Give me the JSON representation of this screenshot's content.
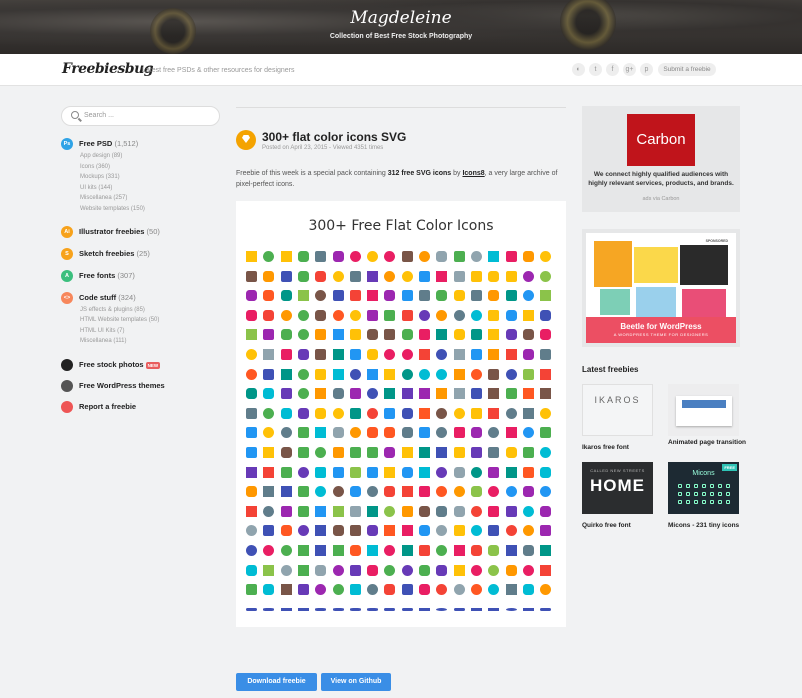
{
  "banner": {
    "title": "Magdeleine",
    "subtitle": "Collection of Best Free Stock Photography"
  },
  "header": {
    "logo": "Freebiesbug",
    "tagline": "Latest free PSDs & other resources for designers",
    "social": [
      "rss-icon",
      "twitter-icon",
      "facebook-icon",
      "google-plus-icon",
      "pinterest-icon"
    ],
    "social_glyphs": [
      "◐",
      "t",
      "f",
      "g+",
      "p"
    ],
    "submit_label": "Submit a freebie"
  },
  "sidebar": {
    "search_placeholder": "Search ...",
    "categories": [
      {
        "badge": "Ps",
        "color": "#2fa3e6",
        "label": "Free PSD",
        "count": "(1,512)",
        "subs": [
          "App design (89)",
          "Icons (360)",
          "Mockups (331)",
          "UI kits (144)",
          "Miscellanea (257)",
          "Website templates (150)"
        ]
      },
      {
        "badge": "Ai",
        "color": "#f7a21b",
        "label": "Illustrator freebies",
        "count": "(50)",
        "subs": []
      },
      {
        "badge": "S",
        "color": "#f7a21b",
        "label": "Sketch freebies",
        "count": "(25)",
        "subs": []
      },
      {
        "badge": "A",
        "color": "#3bbf7d",
        "label": "Free fonts",
        "count": "(307)",
        "subs": []
      },
      {
        "badge": "<>",
        "color": "#f7875b",
        "label": "Code stuff",
        "count": "(324)",
        "subs": [
          "JS effects & plugins (85)",
          "HTML Website templates (50)",
          "HTML UI Kits (7)",
          "Miscellanea (111)"
        ]
      }
    ],
    "extras": [
      {
        "icon": "camera-icon",
        "color": "#222",
        "label": "Free stock photos",
        "new": "NEW"
      },
      {
        "icon": "wordpress-icon",
        "color": "#555",
        "label": "Free WordPress themes",
        "new": ""
      },
      {
        "icon": "alert-icon",
        "color": "#e55",
        "label": "Report a freebie",
        "new": ""
      }
    ]
  },
  "post": {
    "title": "300+ flat color icons SVG",
    "meta": "Posted on April 23, 2015 - Viewed 4351 times",
    "desc_pre": "Freebie of this week is a special pack containing ",
    "desc_bold": "312 free SVG icons",
    "desc_mid": " by ",
    "desc_link": "Icons8",
    "desc_post": ", a very large archive of pixel-perfect icons.",
    "preview_title": "300+ Free Flat Color Icons",
    "download_label": "Download freebie",
    "github_label": "View on Github"
  },
  "ad": {
    "brand": "Carbon",
    "text": "We connect highly qualified audiences with highly relevant services, products, and brands.",
    "via": "ads via Carbon"
  },
  "beetle": {
    "title": "Beetle for WordPress",
    "subtitle": "A WORDPRESS THEME FOR DESIGNERS",
    "sponsored": "SPONSORED"
  },
  "latest": {
    "heading": "Latest freebies",
    "items": [
      {
        "caption": "Ikaros free font",
        "thumb_text": "IKAROS"
      },
      {
        "caption": "Animated page transition",
        "thumb_text": ""
      },
      {
        "caption": "Quirko free font",
        "thumb_text": "HOME",
        "thumb_small": "CALLED NEW STREETS"
      },
      {
        "caption": "Micons - 231 tiny icons",
        "thumb_text": "Micons",
        "badge": "FREE"
      }
    ]
  },
  "colors": {
    "accent": "#3a8ee6",
    "icon_palette": [
      "#2196f3",
      "#4caf50",
      "#ff9800",
      "#f44336",
      "#9c27b0",
      "#3f51b5",
      "#00bcd4",
      "#ffc107",
      "#795548",
      "#607d8b",
      "#e91e63",
      "#8bc34a",
      "#673ab7",
      "#ff5722",
      "#009688",
      "#90a4ae"
    ]
  }
}
